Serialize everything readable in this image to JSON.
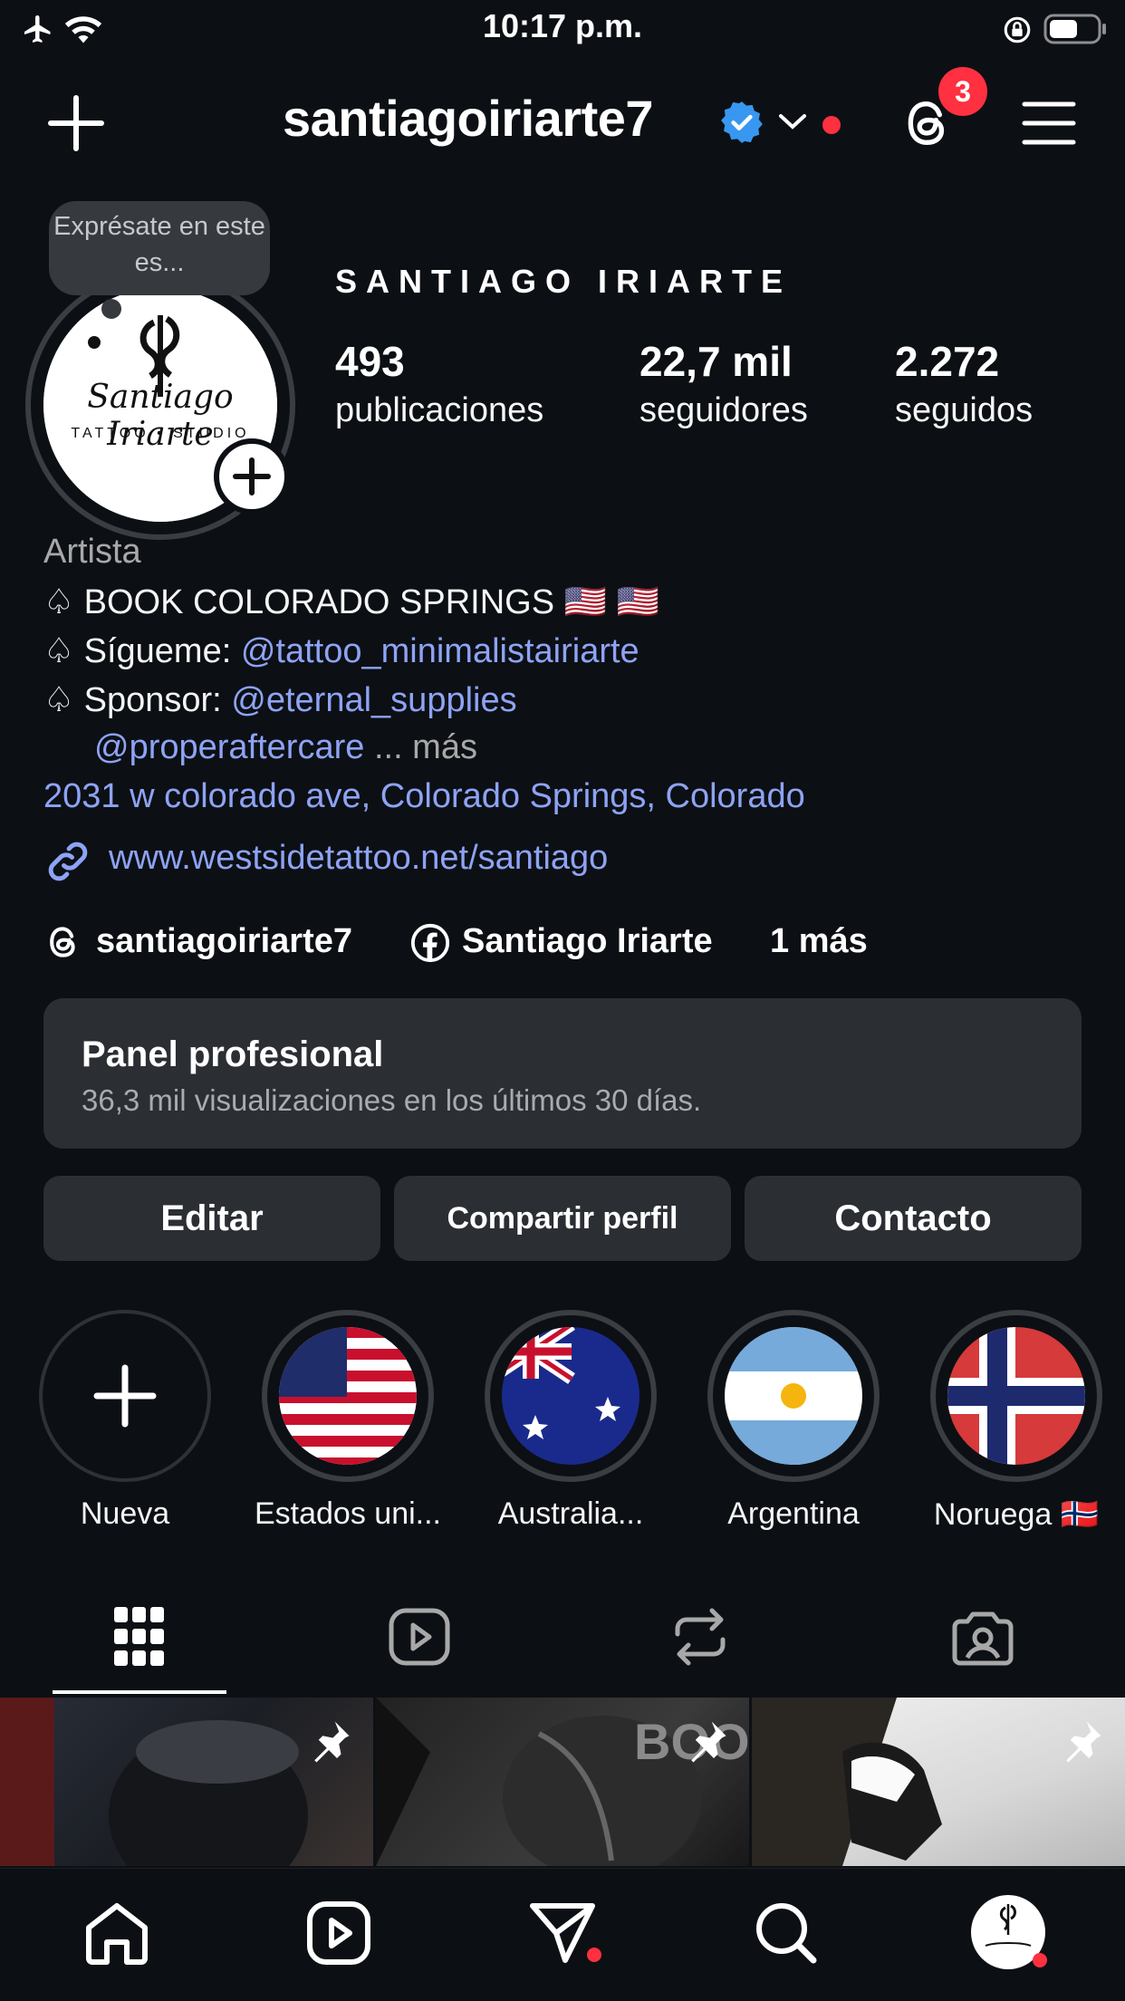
{
  "status_bar": {
    "time": "10:17 p.m."
  },
  "header": {
    "username": "santiagoiriarte7",
    "threads_badge": "3",
    "icons": [
      "add-icon",
      "verified-icon",
      "chevron-down-icon",
      "threads-icon",
      "menu-icon"
    ]
  },
  "profile": {
    "note": "Exprésate en este es...",
    "display_name": "SANTIAGO IRIARTE",
    "avatar_text": "Santiago Iriarte",
    "avatar_sub": "TATTOO • STUDIO",
    "stats": [
      {
        "value": "493",
        "label": "publicaciones"
      },
      {
        "value": "22,7 mil",
        "label": "seguidores"
      },
      {
        "value": "2.272",
        "label": "seguidos"
      }
    ]
  },
  "bio": {
    "category": "Artista",
    "line1": "♤ BOOK COLORADO SPRINGS 🇺🇸 🇺🇸",
    "line2_prefix": "♤ Sígueme: ",
    "line2_link": "@tattoo_minimalistairiarte",
    "line3_prefix": "♤ Sponsor:  ",
    "line3_link": "@eternal_supplies",
    "line4_link": "@properaftercare",
    "line4_more": " ... más",
    "address": "2031  w colorado ave, Colorado Springs, Colorado",
    "website": "www.westsidetattoo.net/santiago"
  },
  "links": {
    "threads": "santiagoiriarte7",
    "facebook": "Santiago Iriarte",
    "more": "1 más"
  },
  "panel": {
    "title": "Panel profesional",
    "subtitle": "36,3 mil visualizaciones en los últimos 30 días."
  },
  "buttons": {
    "edit": "Editar",
    "share": "Compartir perfil",
    "contact": "Contacto"
  },
  "highlights": [
    {
      "label": "Nueva"
    },
    {
      "label": "Estados uni..."
    },
    {
      "label": "Australia..."
    },
    {
      "label": "Argentina"
    },
    {
      "label": "Noruega 🇳🇴"
    }
  ],
  "tile_texts": {
    "tile2": "BOO"
  },
  "colors": {
    "background": "#0c1014",
    "link": "#8ea3f5",
    "verified": "#3897f0",
    "notification": "#ff3040"
  }
}
